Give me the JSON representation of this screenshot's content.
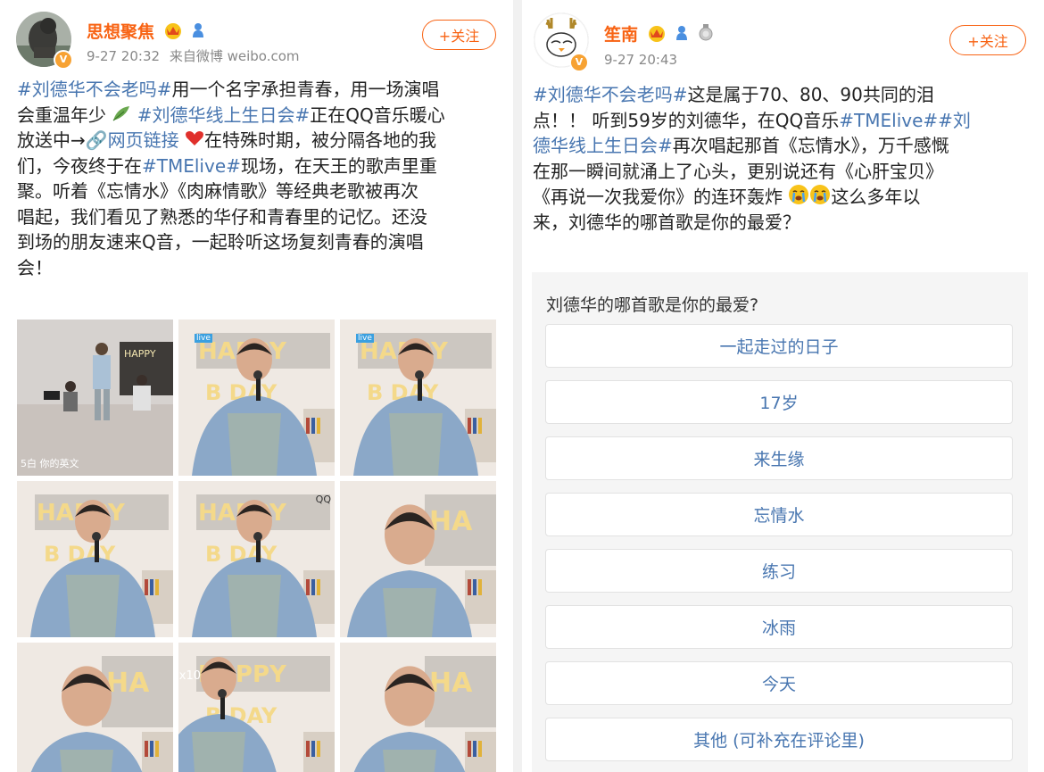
{
  "left_post": {
    "username": "思想聚焦",
    "timestamp": "9-27 20:32",
    "source": "来自微博 weibo.com",
    "follow_label": "+关注",
    "text_lines": [
      [
        {
          "t": "tag",
          "v": "#刘德华不会老吗#"
        },
        {
          "t": "text",
          "v": "用一个名字承担青春，用一场演唱"
        }
      ],
      [
        {
          "t": "text",
          "v": "会重温年少 "
        },
        {
          "t": "emoji",
          "v": "leaf"
        },
        {
          "t": "text",
          "v": " "
        },
        {
          "t": "tag",
          "v": "#刘德华线上生日会#"
        },
        {
          "t": "text",
          "v": "正在QQ音乐暖心"
        }
      ],
      [
        {
          "t": "text",
          "v": "放送中→"
        },
        {
          "t": "link",
          "v": "🔗网页链接"
        },
        {
          "t": "text",
          "v": " "
        },
        {
          "t": "emoji",
          "v": "heart"
        },
        {
          "t": "text",
          "v": "在特殊时期，被分隔各地的我"
        }
      ],
      [
        {
          "t": "text",
          "v": "们，今夜终于在"
        },
        {
          "t": "tag",
          "v": "#TMElive#"
        },
        {
          "t": "text",
          "v": "现场，在天王的歌声里重"
        }
      ],
      [
        {
          "t": "text",
          "v": "聚。听着《忘情水》《肉麻情歌》等经典老歌被再次"
        }
      ],
      [
        {
          "t": "text",
          "v": "唱起，我们看见了熟悉的华仔和青春里的记忆。还没"
        }
      ],
      [
        {
          "t": "text",
          "v": "到场的朋友速来Q音，一起聆听这场复刻青春的演唱"
        }
      ],
      [
        {
          "t": "text",
          "v": "会！"
        }
      ]
    ],
    "photos": [
      {
        "name": "photo-1",
        "overlay": "5白 你的英文"
      },
      {
        "name": "photo-2",
        "overlay": "live"
      },
      {
        "name": "photo-3",
        "overlay": "live"
      },
      {
        "name": "photo-4",
        "overlay": ""
      },
      {
        "name": "photo-5",
        "overlay": "QQ"
      },
      {
        "name": "photo-6",
        "overlay": ""
      },
      {
        "name": "photo-7",
        "overlay": ""
      },
      {
        "name": "photo-8",
        "overlay": "x10"
      },
      {
        "name": "photo-9",
        "overlay": ""
      }
    ]
  },
  "right_post": {
    "username": "笙南",
    "timestamp": "9-27 20:43",
    "follow_label": "+关注",
    "text_lines": [
      [
        {
          "t": "tag",
          "v": "#刘德华不会老吗#"
        },
        {
          "t": "text",
          "v": "这是属于70、80、90共同的泪"
        }
      ],
      [
        {
          "t": "text",
          "v": "点！！ 听到59岁的刘德华，在QQ音乐"
        },
        {
          "t": "tag",
          "v": "#TMElive##刘"
        }
      ],
      [
        {
          "t": "tag",
          "v": "德华线上生日会#"
        },
        {
          "t": "text",
          "v": "再次唱起那首《忘情水》，万千感慨"
        }
      ],
      [
        {
          "t": "text",
          "v": "在那一瞬间就涌上了心头，更别说还有《心肝宝贝》"
        }
      ],
      [
        {
          "t": "text",
          "v": "《再说一次我爱你》的连环轰炸 "
        },
        {
          "t": "emoji",
          "v": "cry"
        },
        {
          "t": "emoji",
          "v": "cry"
        },
        {
          "t": "text",
          "v": "这么多年以"
        }
      ],
      [
        {
          "t": "text",
          "v": "来，刘德华的哪首歌是你的最爱？"
        }
      ]
    ],
    "poll": {
      "question": "刘德华的哪首歌是你的最爱?",
      "options": [
        "一起走过的日子",
        "17岁",
        "来生缘",
        "忘情水",
        "练习",
        "冰雨",
        "今天",
        "其他 (可补充在评论里)"
      ]
    }
  },
  "colors": {
    "accent": "#f86313",
    "link": "#4876b0",
    "text": "#222222",
    "meta": "#888888"
  }
}
